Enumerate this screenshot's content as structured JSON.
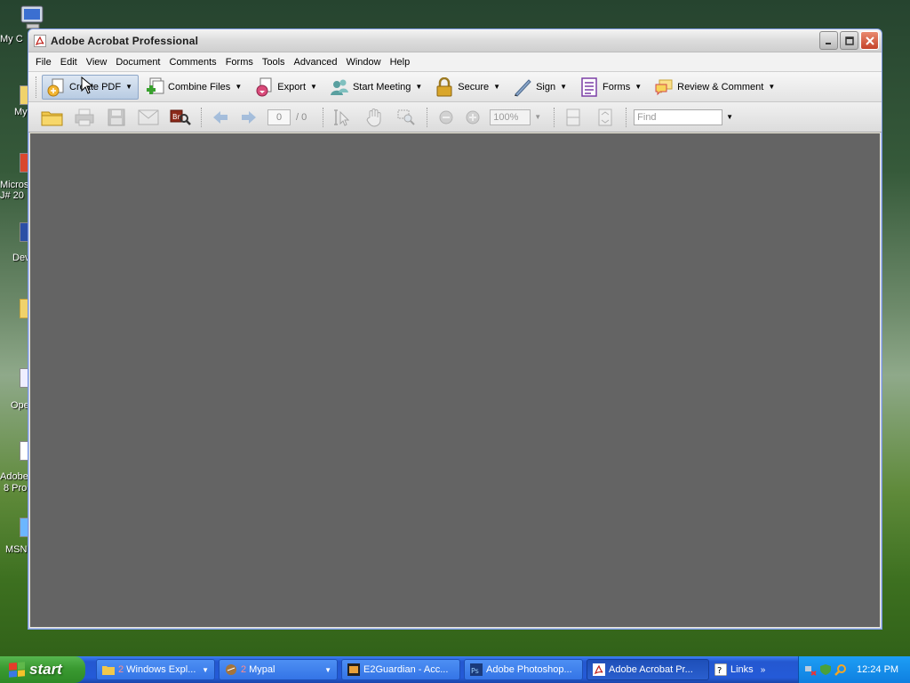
{
  "desktop": {
    "icons": [
      {
        "label": "My C"
      },
      {
        "label": "My"
      },
      {
        "label": "Micros"
      },
      {
        "label": "J# 20"
      },
      {
        "label": "Dev"
      },
      {
        "label": "Ope"
      },
      {
        "label": "Adobe"
      },
      {
        "label": "8 Pro"
      },
      {
        "label": "MSN"
      }
    ]
  },
  "window": {
    "title": "Adobe Acrobat Professional",
    "menu": [
      "File",
      "Edit",
      "View",
      "Document",
      "Comments",
      "Forms",
      "Tools",
      "Advanced",
      "Window",
      "Help"
    ],
    "toolbar": [
      {
        "label": "Create PDF",
        "icon": "create-pdf-icon"
      },
      {
        "label": "Combine Files",
        "icon": "combine-files-icon"
      },
      {
        "label": "Export",
        "icon": "export-icon"
      },
      {
        "label": "Start Meeting",
        "icon": "meeting-icon"
      },
      {
        "label": "Secure",
        "icon": "lock-icon"
      },
      {
        "label": "Sign",
        "icon": "pen-icon"
      },
      {
        "label": "Forms",
        "icon": "form-icon"
      },
      {
        "label": "Review & Comment",
        "icon": "comment-icon"
      }
    ],
    "nav": {
      "page_current": "0",
      "page_total": "/ 0",
      "zoom": "100%",
      "find_placeholder": "Find"
    }
  },
  "taskbar": {
    "start_label": "start",
    "buttons": [
      {
        "badge": "2",
        "label": "Windows Expl..."
      },
      {
        "badge": "2",
        "label": "Mypal"
      },
      {
        "label": "E2Guardian - Acc..."
      },
      {
        "label": "Adobe Photoshop..."
      },
      {
        "label": "Adobe Acrobat Pr..."
      }
    ],
    "links_label": "Links",
    "clock": "12:24 PM"
  }
}
